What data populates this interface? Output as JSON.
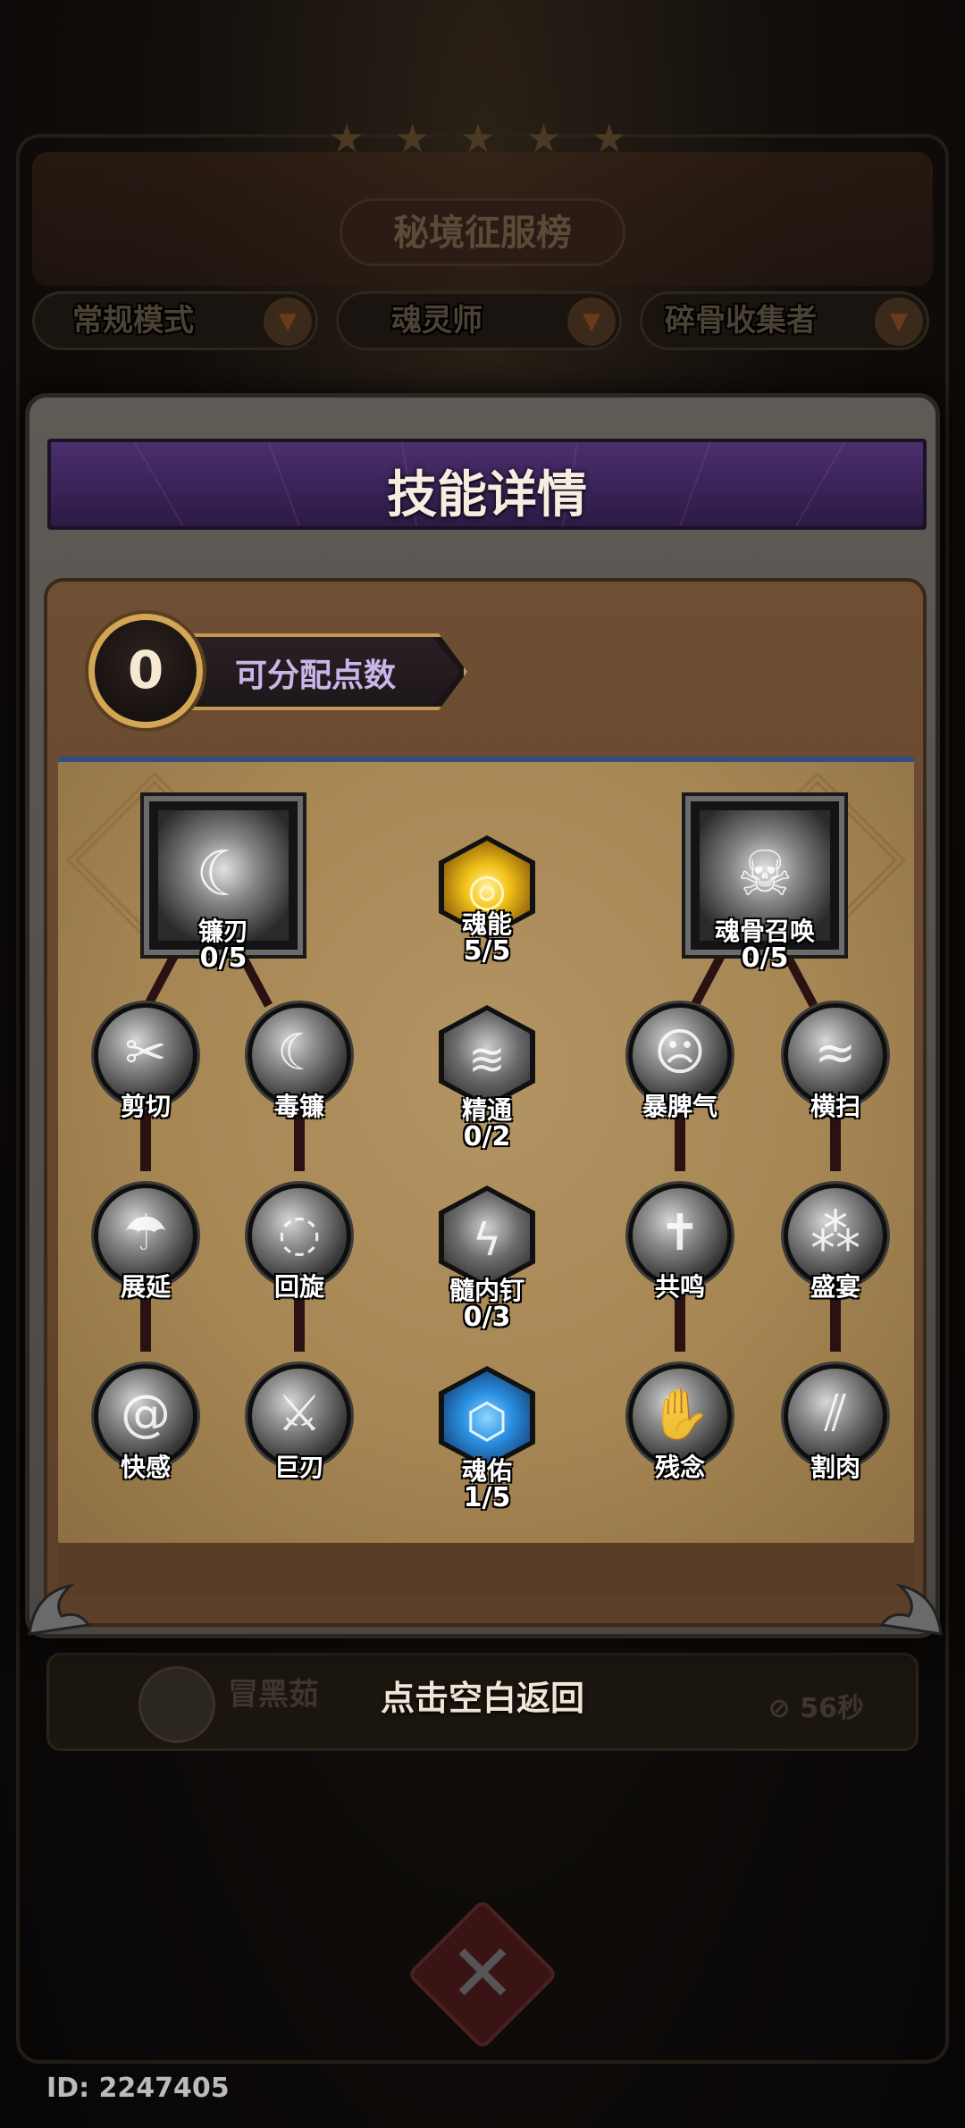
{
  "background": {
    "title": "秘境征服榜",
    "dropdowns": [
      {
        "label": "常规模式",
        "arrow": "▼"
      },
      {
        "label": "魂灵师",
        "arrow": "▼"
      },
      {
        "label": "碎骨收集者",
        "arrow": "▼"
      }
    ],
    "row": {
      "name": "冒黑茹",
      "time": "⊘ 56秒"
    },
    "close_glyph": "✕"
  },
  "dialog": {
    "title": "技能详情",
    "points": {
      "value": "0",
      "label": "可分配点数"
    }
  },
  "skills": {
    "lian_ren": {
      "label": "镰刃",
      "count": "0/5",
      "icon": "scythe-icon"
    },
    "hun_neng": {
      "label": "魂能",
      "count": "5/5",
      "icon": "soul-orb-icon"
    },
    "hun_gu_zhao": {
      "label": "魂骨召唤",
      "count": "0/5",
      "icon": "bone-summon-icon"
    },
    "jian_qie": {
      "label": "剪切",
      "icon": "cut-icon"
    },
    "du_lian": {
      "label": "毒镰",
      "icon": "poison-scythe-icon"
    },
    "jing_tong": {
      "label": "精通",
      "count": "0/2",
      "icon": "mastery-icon"
    },
    "bao_pi_qi": {
      "label": "暴脾气",
      "icon": "temper-icon"
    },
    "heng_sao": {
      "label": "横扫",
      "icon": "sweep-icon"
    },
    "zhan_yan": {
      "label": "展延",
      "icon": "extend-icon"
    },
    "hui_xuan": {
      "label": "回旋",
      "icon": "whirl-icon"
    },
    "sui_nei_ding": {
      "label": "髓内钉",
      "count": "0/3",
      "icon": "marrow-nail-icon"
    },
    "gong_ming": {
      "label": "共鸣",
      "icon": "resonance-icon"
    },
    "sheng_yan": {
      "label": "盛宴",
      "icon": "feast-icon"
    },
    "kuai_gan": {
      "label": "快感",
      "icon": "thrill-icon"
    },
    "ju_ren": {
      "label": "巨刃",
      "icon": "great-blade-icon"
    },
    "hun_you": {
      "label": "魂佑",
      "count": "1/5",
      "icon": "soul-blessing-icon"
    },
    "can_nian": {
      "label": "残念",
      "icon": "lingering-icon"
    },
    "ge_rou": {
      "label": "割肉",
      "icon": "flesh-cut-icon"
    }
  },
  "hint": "点击空白返回",
  "user_id": "ID: 2247405"
}
